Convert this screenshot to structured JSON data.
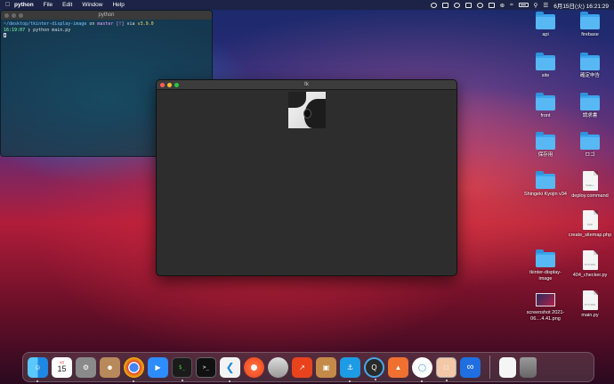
{
  "menubar": {
    "app_name": "python",
    "menus": [
      "File",
      "Edit",
      "Window",
      "Help"
    ],
    "clock": "6月15日(火)  16:21:29"
  },
  "terminal": {
    "title": "python",
    "line1_path": "~/desktop/tkinter-display-image",
    "line1_on": "on",
    "line1_branch": "master [!]",
    "line1_via": "via",
    "line1_version": "v3.9.0",
    "line2_time": "16:19:07",
    "line2_cmd": "python main.py"
  },
  "tk_window": {
    "title": "tk"
  },
  "desktop": {
    "items": [
      {
        "label": "api",
        "type": "folder"
      },
      {
        "label": "firebase",
        "type": "folder"
      },
      {
        "label": "site",
        "type": "folder"
      },
      {
        "label": "確定申告",
        "type": "folder"
      },
      {
        "label": "front",
        "type": "folder"
      },
      {
        "label": "請求書",
        "type": "folder"
      },
      {
        "label": "保存用",
        "type": "folder"
      },
      {
        "label": "ロゴ",
        "type": "folder"
      },
      {
        "label": "Shingeki Kyojin v34",
        "type": "folder"
      },
      {
        "label": "deploy.command",
        "type": "file",
        "tag": "SHELL"
      },
      {
        "label": "create_sitemap.php",
        "type": "file",
        "tag": "PHP"
      },
      {
        "label": "tkinter-display-image",
        "type": "folder"
      },
      {
        "label": "404_checker.py",
        "type": "file",
        "tag": "PYTHON"
      },
      {
        "label": "screenshot 2021-06....4.41.png",
        "type": "image"
      },
      {
        "label": "main.py",
        "type": "file",
        "tag": "PYTHON"
      }
    ]
  },
  "dock": {
    "calendar_month": "6月",
    "calendar_day": "15",
    "apps": [
      "finder-icon",
      "calendar-icon",
      "system-preferences-icon",
      "contacts-icon",
      "chrome-icon",
      "zoom-icon",
      "terminal-icon",
      "terminal-alt-icon",
      "vscode-icon",
      "safari-icon",
      "sequel-icon",
      "charts-icon",
      "archive-icon",
      "docker-icon",
      "quicktime-icon",
      "sourcetree-icon",
      "github-desktop-icon",
      "preview-icon",
      "infinity-icon",
      "document-icon",
      "trash-icon"
    ]
  }
}
